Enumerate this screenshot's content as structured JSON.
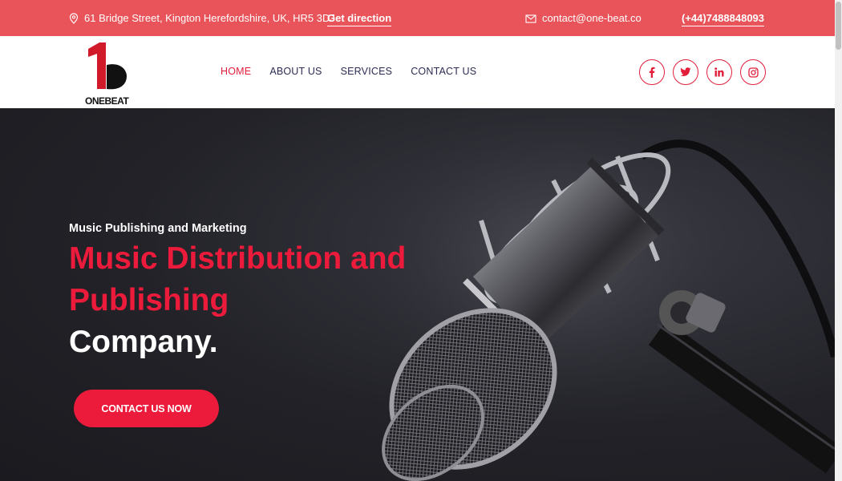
{
  "topbar": {
    "address": "61 Bridge Street, Kington Herefordshire, UK, HR5 3DJ",
    "direction_link": "Get direction",
    "email": "contact@one-beat.co",
    "phone": "(+44)7488848093"
  },
  "brand": {
    "logo_mark": "1",
    "logo_text": "ONEBEAT"
  },
  "nav": {
    "items": [
      "HOME",
      "ABOUT US",
      "SERVICES",
      "CONTACT US"
    ],
    "active": "HOME"
  },
  "social": {
    "facebook": "f",
    "twitter": "t",
    "linkedin": "in",
    "instagram": "ig"
  },
  "hero": {
    "kicker": "Music Publishing and Marketing",
    "title_line1": "Music Distribution and",
    "title_line2": "Publishing",
    "title_line3": "Company.",
    "cta_label": "CONTACT US NOW"
  },
  "colors": {
    "topbar": "#e8545a",
    "accent": "#ec1b3b",
    "nav_text": "#2c2c54"
  }
}
